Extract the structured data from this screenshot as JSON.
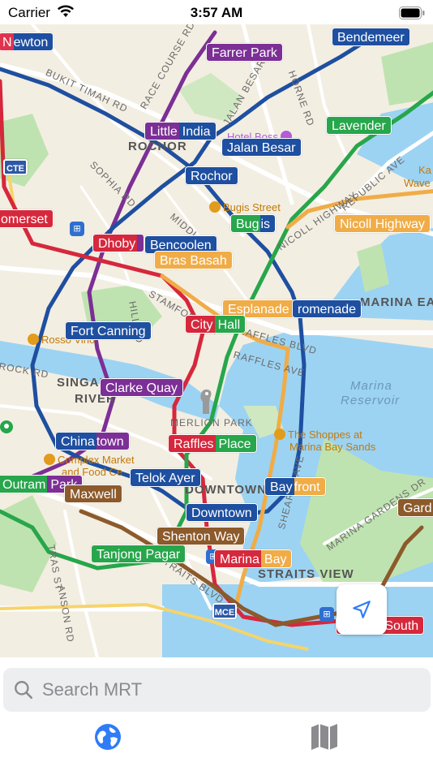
{
  "status_bar": {
    "carrier": "Carrier",
    "time": "3:57 AM"
  },
  "map": {
    "places": [
      {
        "id": "rochor-area",
        "text": "ROCHOR"
      },
      {
        "id": "singapore-river-1",
        "text": "SINGAPORE"
      },
      {
        "id": "singapore-river-2",
        "text": "RIVER"
      },
      {
        "id": "merlion-park",
        "text": "MERLION PARK"
      },
      {
        "id": "downtown-core",
        "text": "DOWNTOWN CORE"
      },
      {
        "id": "straits-view",
        "text": "STRAITS VIEW"
      },
      {
        "id": "marina-east",
        "text": "MARINA EAST"
      },
      {
        "id": "marina-reservoir-1",
        "text": "Marina"
      },
      {
        "id": "marina-reservoir-2",
        "text": "Reservoir"
      }
    ],
    "roads": [
      {
        "id": "bukit-timah",
        "text": "BUKIT TIMAH RD"
      },
      {
        "id": "race-course",
        "text": "RACE COURSE RD"
      },
      {
        "id": "sophia",
        "text": "SOPHIA RD"
      },
      {
        "id": "jalan-besar-rd",
        "text": "JALAN BESAR"
      },
      {
        "id": "horne",
        "text": "HORNE RD"
      },
      {
        "id": "middle",
        "text": "MIDDLE RD"
      },
      {
        "id": "nicoll",
        "text": "NICOLL HIGHWAY"
      },
      {
        "id": "republic",
        "text": "REPUBLIC AVE"
      },
      {
        "id": "stamford",
        "text": "STAMFORD RD"
      },
      {
        "id": "raffles-blvd",
        "text": "RAFFLES BLVD"
      },
      {
        "id": "raffles-ave",
        "text": "RAFFLES AVE"
      },
      {
        "id": "marina-gardens",
        "text": "MARINA GARDENS DR"
      },
      {
        "id": "straits-blvd",
        "text": "STRAITS BLVD"
      },
      {
        "id": "sheares",
        "text": "SHEARES AVE"
      },
      {
        "id": "trans",
        "text": "TRAS ST"
      },
      {
        "id": "anson",
        "text": "ANSON RD"
      },
      {
        "id": "hill",
        "text": "HILL RD"
      },
      {
        "id": "clemenceau",
        "text": "ROCK RD"
      }
    ],
    "pois": [
      {
        "id": "bugis-street",
        "text": "Bugis Street",
        "color": "#e39b1b"
      },
      {
        "id": "shoppes",
        "text": "The Shoppes at",
        "color": "#e39b1b"
      },
      {
        "id": "shoppes-2",
        "text": "Marina Bay Sands",
        "color": "#e39b1b"
      },
      {
        "id": "complex-market",
        "text": "Complex Market",
        "color": "#e39b1b"
      },
      {
        "id": "complex-market-2",
        "text": "and Food Ce",
        "color": "#e39b1b"
      },
      {
        "id": "rossi-villa",
        "text": "Rosso Vino",
        "color": "#e39b1b"
      },
      {
        "id": "hotel-boss",
        "text": "Hotel Boss",
        "color": "#b45bd6"
      },
      {
        "id": "kallang-wave-1",
        "text": "Ka",
        "color": "#e39b1b"
      },
      {
        "id": "kallang-wave-2",
        "text": "Wave",
        "color": "#e39b1b"
      }
    ],
    "shields": [
      "CTE",
      "MCE"
    ],
    "stations": [
      {
        "id": "newton",
        "label": "ewton",
        "color": "#e0334d",
        "color2": "#1e4fa0"
      },
      {
        "id": "bendemeer",
        "label": "Bendemeer",
        "color": "#1e4fa0"
      },
      {
        "id": "farrer-park",
        "label": "Farrer Park",
        "color": "#7c2f95"
      },
      {
        "id": "little-india",
        "label": "Little India",
        "color": "#7c2f95",
        "color2": "#1e4fa0"
      },
      {
        "id": "lavender",
        "label": "Lavender",
        "color": "#27a64b"
      },
      {
        "id": "jalan-besar",
        "label": "Jalan Besar",
        "color": "#1e4fa0"
      },
      {
        "id": "rochor",
        "label": "Rochor",
        "color": "#1e4fa0"
      },
      {
        "id": "bugis",
        "label": "Bugis",
        "color": "#27a64b",
        "color2": "#1e4fa0"
      },
      {
        "id": "nicoll-highway",
        "label": "Nicoll Highway",
        "color": "#f0ac47"
      },
      {
        "id": "somerset",
        "label": "omerset",
        "color": "#d6283c"
      },
      {
        "id": "dhoby-ghaut",
        "label": "Dhoby",
        "color": "#d6283c",
        "color2": "#7c2f95"
      },
      {
        "id": "bencoolen",
        "label": "Bencoolen",
        "color": "#1e4fa0"
      },
      {
        "id": "bras-basah",
        "label": "Bras Basah",
        "color": "#f0ac47"
      },
      {
        "id": "esplanade",
        "label": "Esplanade",
        "color": "#f0ac47"
      },
      {
        "id": "promenade",
        "label": "romenade",
        "color": "#1e4fa0",
        "color2": "#f0ac47"
      },
      {
        "id": "fort-canning",
        "label": "Fort Canning",
        "color": "#1e4fa0"
      },
      {
        "id": "city-hall",
        "label": "City Hall",
        "color": "#d6283c",
        "color2": "#27a64b"
      },
      {
        "id": "clarke-quay",
        "label": "Clarke Quay",
        "color": "#7c2f95"
      },
      {
        "id": "chinatown",
        "label": "Chinatown",
        "color": "#1e4fa0",
        "color2": "#7c2f95"
      },
      {
        "id": "raffles-place",
        "label": "Raffles Place",
        "color": "#d6283c",
        "color2": "#27a64b"
      },
      {
        "id": "telok-ayer",
        "label": "Telok Ayer",
        "color": "#1e4fa0"
      },
      {
        "id": "outram-park",
        "label": "Outram Park",
        "color": "#27a64b",
        "color2": "#7c2f95"
      },
      {
        "id": "maxwell",
        "label": "Maxwell",
        "color": "#8c5a2b"
      },
      {
        "id": "downtown",
        "label": "Downtown",
        "color": "#1e4fa0"
      },
      {
        "id": "bayfront",
        "label": "Bayfront",
        "color": "#1e4fa0",
        "color2": "#f0ac47"
      },
      {
        "id": "shenton-way",
        "label": "Shenton Way",
        "color": "#8c5a2b"
      },
      {
        "id": "tanjong-pagar",
        "label": "Tanjong Pagar",
        "color": "#27a64b"
      },
      {
        "id": "marina-bay",
        "label": "Marina Bay",
        "color": "#d6283c",
        "color2": "#f0ac47"
      },
      {
        "id": "gardens",
        "label": "Gard",
        "color": "#8c5a2b"
      },
      {
        "id": "marina-south",
        "label": "Marina South",
        "color": "#d6283c"
      }
    ]
  },
  "search": {
    "placeholder": "Search MRT",
    "value": ""
  },
  "tabs": [
    {
      "id": "map-tab",
      "icon": "globe-icon",
      "active": true
    },
    {
      "id": "list-tab",
      "icon": "map-icon",
      "active": false
    }
  ],
  "colors": {
    "ns_line": "#d6283c",
    "ew_line": "#27a64b",
    "ne_line": "#7c2f95",
    "cc_line": "#f0ac47",
    "dt_line": "#1e4fa0",
    "te_line": "#8c5a2b",
    "accent": "#2f7cf6"
  }
}
